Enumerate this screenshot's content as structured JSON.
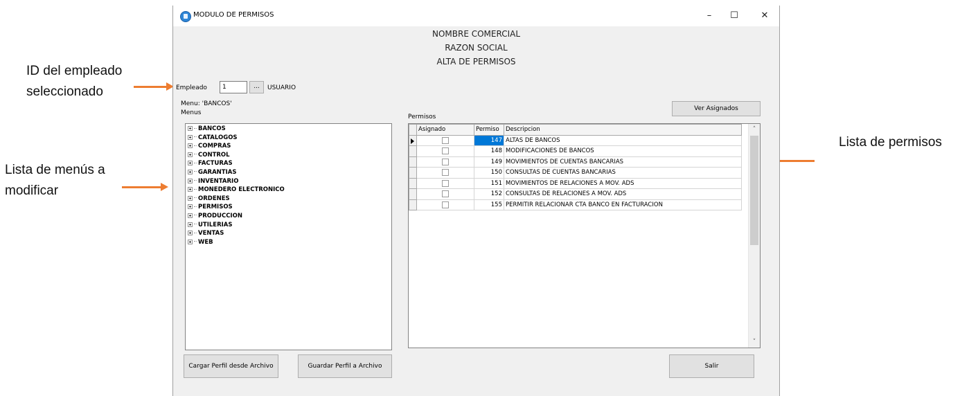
{
  "annotations": {
    "empleado_line1": "ID del empleado",
    "empleado_line2": "seleccionado",
    "menus_line1": "Lista de menús a",
    "menus_line2": "modificar",
    "permisos": "Lista de permisos",
    "arrow_color": "#ed7d31"
  },
  "window": {
    "title": "MODULO DE PERMISOS",
    "minimize": "–",
    "maximize": "☐",
    "close": "✕"
  },
  "header": {
    "line1": "NOMBRE COMERCIAL",
    "line2": "RAZON SOCIAL",
    "line3": "ALTA DE PERMISOS"
  },
  "empleado": {
    "label": "Empleado",
    "value": "1",
    "browse_label": "...",
    "name": "USUARIO"
  },
  "menu_selected": "Menu: 'BANCOS'",
  "menus": {
    "label": "Menus",
    "items": [
      "BANCOS",
      "CATALOGOS",
      "COMPRAS",
      "CONTROL",
      "FACTURAS",
      "GARANTIAS",
      "INVENTARIO",
      "MONEDERO ELECTRONICO",
      "ORDENES",
      "PERMISOS",
      "PRODUCCION",
      "UTILERIAS",
      "VENTAS",
      "WEB"
    ]
  },
  "ver_asignados_label": "Ver Asignados",
  "permisos": {
    "label": "Permisos",
    "columns": [
      "Asignado",
      "Permiso",
      "Descripcion"
    ],
    "rows": [
      {
        "asignado": false,
        "permiso": "147",
        "descripcion": "ALTAS DE BANCOS"
      },
      {
        "asignado": false,
        "permiso": "148",
        "descripcion": "MODIFICACIONES DE BANCOS"
      },
      {
        "asignado": false,
        "permiso": "149",
        "descripcion": "MOVIMIENTOS DE CUENTAS BANCARIAS"
      },
      {
        "asignado": false,
        "permiso": "150",
        "descripcion": "CONSULTAS DE CUENTAS BANCARIAS"
      },
      {
        "asignado": false,
        "permiso": "151",
        "descripcion": "MOVIMIENTOS DE RELACIONES A MOV. ADS"
      },
      {
        "asignado": false,
        "permiso": "152",
        "descripcion": "CONSULTAS DE RELACIONES A MOV. ADS"
      },
      {
        "asignado": false,
        "permiso": "155",
        "descripcion": "PERMITIR RELACIONAR CTA BANCO EN FACTURACION"
      }
    ]
  },
  "buttons": {
    "cargar": "Cargar Perfil desde Archivo",
    "guardar": "Guardar Perfil a Archivo",
    "salir": "Salir"
  },
  "scroll": {
    "up": "˄",
    "down": "˅"
  }
}
